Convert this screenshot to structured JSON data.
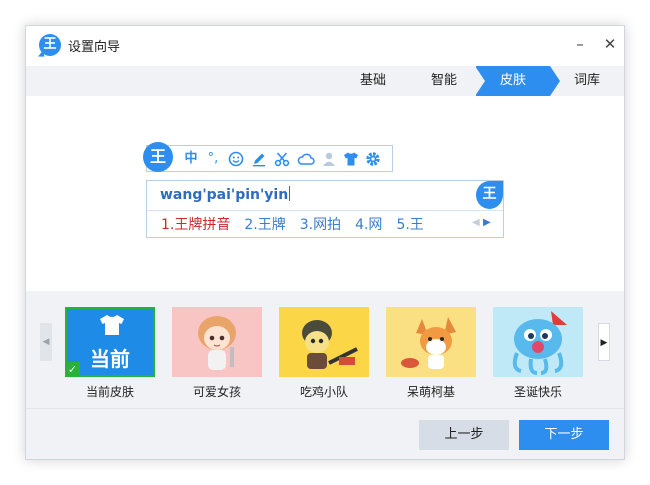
{
  "window": {
    "title": "设置向导",
    "minimize_icon": "minimize-icon",
    "close_icon": "close-icon"
  },
  "tabs": [
    {
      "label": "基础",
      "active": false
    },
    {
      "label": "智能",
      "active": false
    },
    {
      "label": "皮肤",
      "active": true
    },
    {
      "label": "词库",
      "active": false
    }
  ],
  "toolbar": {
    "logo": "王",
    "chinese_mode": "中",
    "icons": [
      "punctuation-icon",
      "emoji-icon",
      "handwrite-icon",
      "scissors-icon",
      "cloud-icon",
      "user-icon",
      "skin-icon",
      "settings-icon"
    ]
  },
  "candidate": {
    "pinyin": "wang'pai'pin'yin",
    "badge": "王",
    "items": [
      "1.王牌拼音",
      "2.王牌",
      "3.网拍",
      "4.网",
      "5.王"
    ]
  },
  "skins": [
    {
      "label": "当前皮肤",
      "thumb_text": "当前",
      "current": true
    },
    {
      "label": "可爱女孩",
      "current": false
    },
    {
      "label": "吃鸡小队",
      "current": false
    },
    {
      "label": "呆萌柯基",
      "current": false
    },
    {
      "label": "圣诞快乐",
      "current": false
    }
  ],
  "buttons": {
    "prev": "上一步",
    "next": "下一步"
  },
  "colors": {
    "accent": "#2e8ef0",
    "current_border": "#27b33a",
    "candidate_first": "#d0262c"
  }
}
